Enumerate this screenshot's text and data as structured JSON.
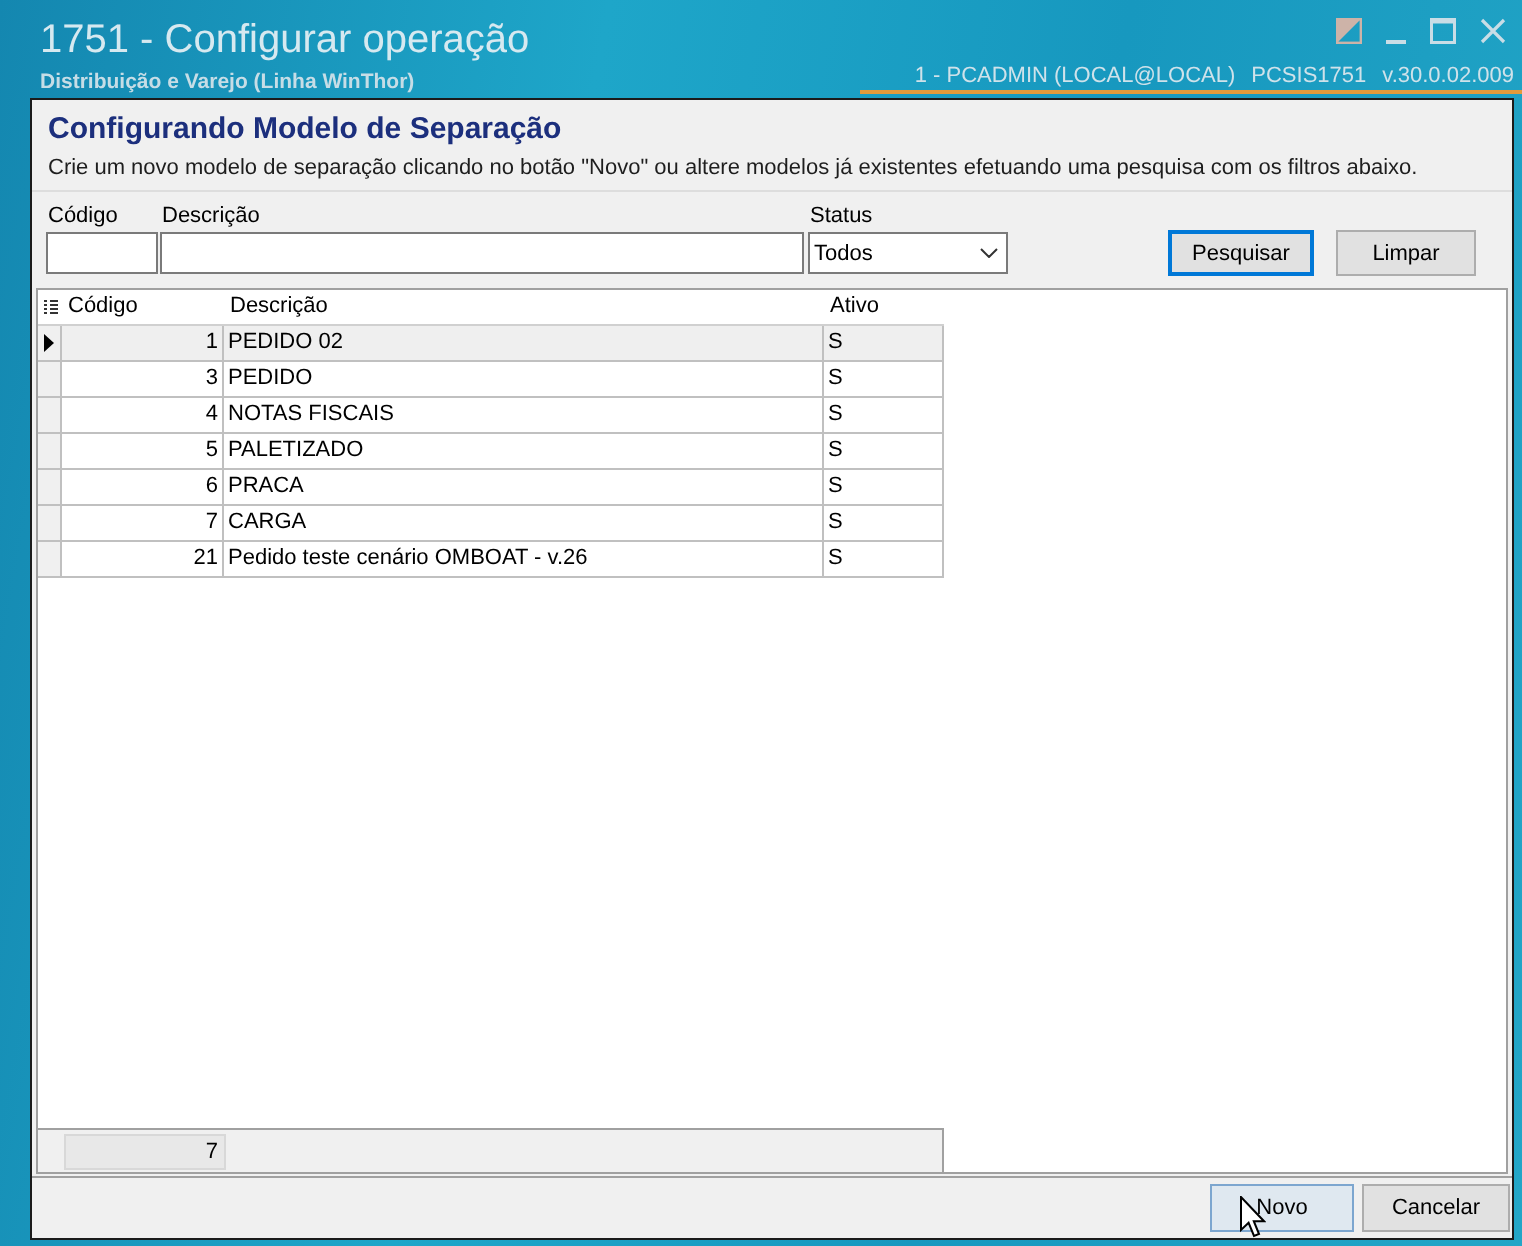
{
  "window": {
    "title": "1751 - Configurar operação",
    "subtitle": "Distribuição e Varejo (Linha WinThor)",
    "session": "1 - PCADMIN (LOCAL@LOCAL)",
    "program": "PCSIS1751",
    "version": "v.30.0.02.009"
  },
  "header": {
    "title": "Configurando Modelo de Separação",
    "description": "Crie um novo modelo de separação clicando no botão \"Novo\" ou altere modelos já existentes efetuando uma pesquisa com os filtros abaixo."
  },
  "filters": {
    "fields": [
      {
        "label": "Código",
        "kind": "text"
      },
      {
        "label": "Descrição",
        "kind": "text"
      },
      {
        "label": "Status",
        "kind": "select",
        "value": "Todos"
      }
    ],
    "buttons": [
      {
        "label": "Pesquisar",
        "focused": true
      },
      {
        "label": "Limpar",
        "focused": false
      }
    ]
  },
  "grid": {
    "columns": [
      "Código",
      "Descrição",
      "Ativo"
    ],
    "rows": [
      {
        "cells": [
          "1",
          "PEDIDO 02",
          "S"
        ],
        "selected": true
      },
      {
        "cells": [
          "3",
          "PEDIDO",
          "S"
        ],
        "selected": false
      },
      {
        "cells": [
          "4",
          "NOTAS FISCAIS",
          "S"
        ],
        "selected": false
      },
      {
        "cells": [
          "5",
          "PALETIZADO",
          "S"
        ],
        "selected": false
      },
      {
        "cells": [
          "6",
          "PRACA",
          "S"
        ],
        "selected": false
      },
      {
        "cells": [
          "7",
          "CARGA",
          "S"
        ],
        "selected": false
      },
      {
        "cells": [
          "21",
          "Pedido teste cenário OMBOAT - v.26",
          "S"
        ],
        "selected": false
      }
    ],
    "footer": {
      "count": "7"
    }
  },
  "actions": [
    {
      "label": "Novo",
      "hovered": true
    },
    {
      "label": "Cancelar",
      "hovered": false
    }
  ]
}
